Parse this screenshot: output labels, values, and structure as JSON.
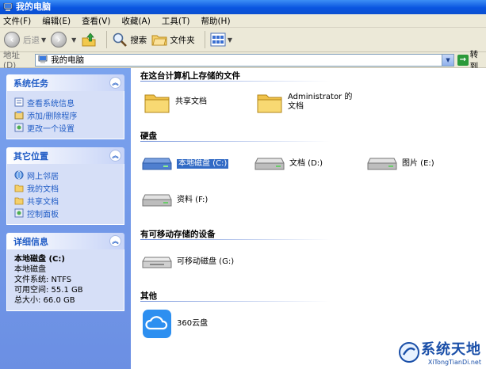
{
  "window": {
    "title": "我的电脑"
  },
  "menu": [
    "文件(F)",
    "编辑(E)",
    "查看(V)",
    "收藏(A)",
    "工具(T)",
    "帮助(H)"
  ],
  "toolbar": {
    "back_label": "后退",
    "search_label": "搜索",
    "folders_label": "文件夹"
  },
  "address": {
    "label": "地址(D)",
    "value": "我的电脑",
    "go_label": "转到"
  },
  "left": {
    "system_tasks": {
      "title": "系统任务",
      "items": [
        "查看系统信息",
        "添加/删除程序",
        "更改一个设置"
      ]
    },
    "other_places": {
      "title": "其它位置",
      "items": [
        "网上邻居",
        "我的文档",
        "共享文档",
        "控制面板"
      ]
    },
    "details": {
      "title": "详细信息",
      "name": "本地磁盘 (C:)",
      "type": "本地磁盘",
      "fs": "文件系统: NTFS",
      "free": "可用空间: 55.1 GB",
      "total": "总大小: 66.0 GB"
    }
  },
  "right": {
    "stored_files": {
      "heading": "在这台计算机上存储的文件",
      "items": [
        "共享文档",
        "Administrator 的文档"
      ]
    },
    "hard_disks": {
      "heading": "硬盘",
      "items": [
        "本地磁盘 (C:)",
        "文档 (D:)",
        "图片 (E:)",
        "资料 (F:)"
      ]
    },
    "removable": {
      "heading": "有可移动存储的设备",
      "items": [
        "可移动磁盘 (G:)"
      ]
    },
    "other": {
      "heading": "其他",
      "items": [
        "360云盘"
      ]
    }
  },
  "watermark": {
    "main": "系统天地",
    "sub": "XiTongTianDi.net"
  }
}
